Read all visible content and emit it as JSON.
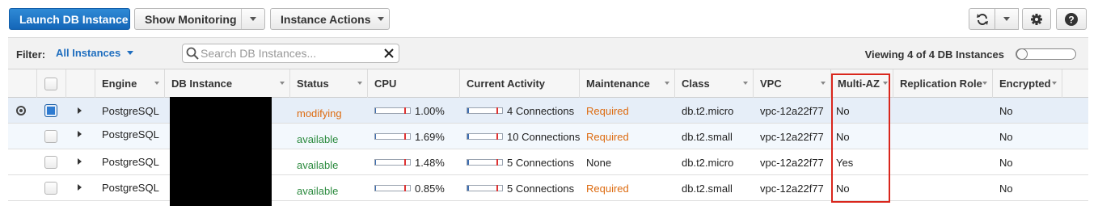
{
  "toolbar": {
    "launch_label": "Launch DB Instance",
    "monitoring_label": "Show Monitoring",
    "actions_label": "Instance Actions",
    "right_icons": [
      "refresh-icon",
      "chevron-down-icon",
      "gear-icon",
      "help-icon"
    ]
  },
  "filter": {
    "label": "Filter:",
    "selected": "All Instances",
    "search_placeholder": "Search DB Instances...",
    "viewing_text": "Viewing 4 of 4 DB Instances"
  },
  "table": {
    "columns": [
      "Engine",
      "DB Instance",
      "Status",
      "CPU",
      "Current Activity",
      "Maintenance",
      "Class",
      "VPC",
      "Multi-AZ",
      "Replication Role",
      "Encrypted"
    ],
    "rows": [
      {
        "engine": "PostgreSQL",
        "status": "modifying",
        "cpu": "1.00%",
        "cpu_pct": 1.0,
        "activity": "4 Connections",
        "maintenance": "Required",
        "class": "db.t2.micro",
        "vpc": "vpc-12a22f77",
        "multi_az": "No",
        "replication_role": "",
        "encrypted": "No",
        "selected": true
      },
      {
        "engine": "PostgreSQL",
        "status": "available",
        "cpu": "1.69%",
        "cpu_pct": 1.69,
        "activity": "10 Connections",
        "maintenance": "Required",
        "class": "db.t2.small",
        "vpc": "vpc-12a22f77",
        "multi_az": "No",
        "replication_role": "",
        "encrypted": "No",
        "selected": false
      },
      {
        "engine": "PostgreSQL",
        "status": "available",
        "cpu": "1.48%",
        "cpu_pct": 1.48,
        "activity": "5 Connections",
        "maintenance": "None",
        "class": "db.t2.micro",
        "vpc": "vpc-12a22f77",
        "multi_az": "Yes",
        "replication_role": "",
        "encrypted": "No",
        "selected": false
      },
      {
        "engine": "PostgreSQL",
        "status": "available",
        "cpu": "0.85%",
        "cpu_pct": 0.85,
        "activity": "5 Connections",
        "maintenance": "Required",
        "class": "db.t2.small",
        "vpc": "vpc-12a22f77",
        "multi_az": "No",
        "replication_role": "",
        "encrypted": "No",
        "selected": false
      }
    ]
  },
  "colors": {
    "primary": "#1466b8",
    "status_modifying": "#dd6b10",
    "status_available": "#2b8a3e",
    "highlight": "#d9261c"
  }
}
